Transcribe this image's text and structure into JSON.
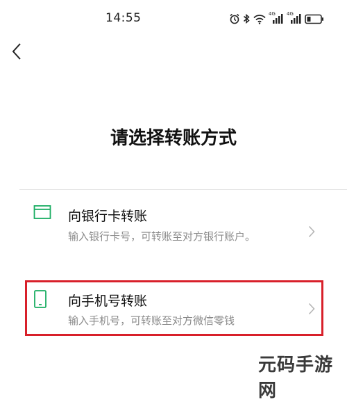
{
  "status_bar": {
    "time": "14:55",
    "icons": [
      "alarm-icon",
      "bluetooth-icon",
      "wifi-icon",
      "signal-4g-icon",
      "signal-4g-icon",
      "battery-icon"
    ],
    "network_label_1": "4G",
    "network_label_2": "4G"
  },
  "nav": {
    "back_icon": "chevron-left-icon"
  },
  "page": {
    "title": "请选择转账方式"
  },
  "options": [
    {
      "icon": "bank-card-icon",
      "title": "向银行卡转账",
      "description": "输入银行卡号，可转账至对方银行账户。"
    },
    {
      "icon": "phone-icon",
      "title": "向手机号转账",
      "description": "输入手机号，可转账至对方微信零钱"
    }
  ],
  "colors": {
    "accent_green": "#1aad62",
    "highlight_red": "#d8202a",
    "desc_gray": "#8a8a8a"
  },
  "watermark": {
    "text": "元码手游网"
  }
}
